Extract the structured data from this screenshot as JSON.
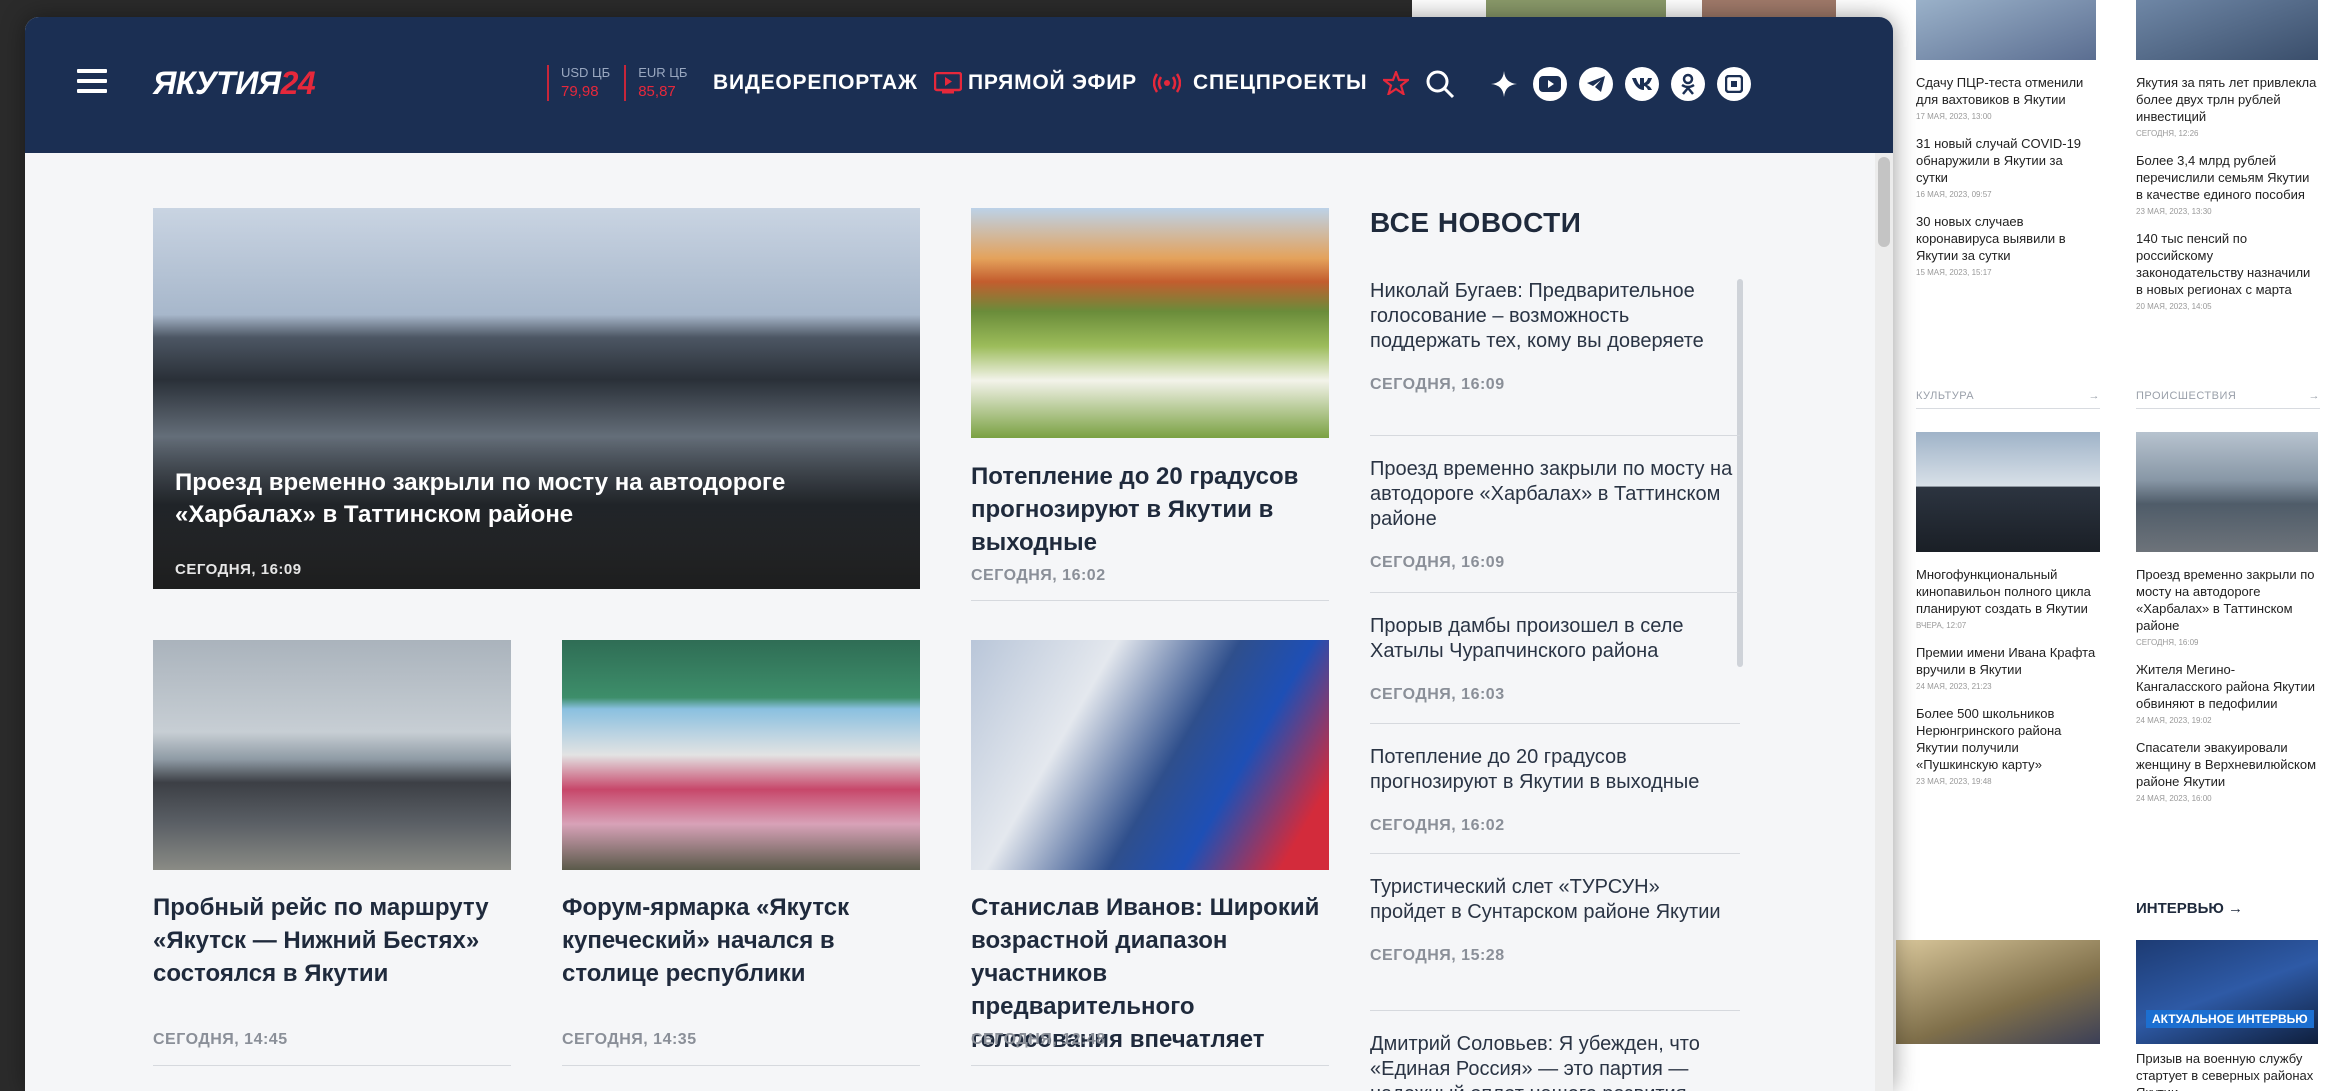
{
  "header": {
    "logo_main": "ЯКУТИЯ",
    "logo_accent": "24",
    "rates": [
      {
        "label": "USD ЦБ",
        "value": "79,98"
      },
      {
        "label": "EUR ЦБ",
        "value": "85,87"
      }
    ],
    "nav": [
      {
        "label": "ВИДЕОРЕПОРТАЖ",
        "icon": "video-icon"
      },
      {
        "label": "ПРЯМОЙ ЭФИР",
        "icon": "broadcast-icon"
      },
      {
        "label": "СПЕЦПРОЕКТЫ",
        "icon": "star-icon"
      }
    ],
    "socials": [
      "zen-icon",
      "youtube-icon",
      "telegram-icon",
      "vk-icon",
      "ok-icon",
      "rutube-icon"
    ]
  },
  "hero": {
    "title": "Проезд временно закрыли по мосту на автодороге «Харбалах» в Таттинском районе",
    "date": "СЕГОДНЯ, 16:09"
  },
  "cards": [
    {
      "title": "Потепление до  20 градусов прогнозируют в Якутии в выходные",
      "date": "СЕГОДНЯ, 16:02"
    },
    {
      "title": "Пробный рейс по маршруту «Якутск — Нижний Бестях» состоялся в Якутии",
      "date": "СЕГОДНЯ, 14:45"
    },
    {
      "title": "Форум-ярмарка «Якутск купеческий» начался в столице республики",
      "date": "СЕГОДНЯ, 14:35"
    },
    {
      "title": "Станислав Иванов: Широкий возрастной диапазон участников предварительного голосования впечатляет",
      "date": "СЕГОДНЯ, 12:48"
    }
  ],
  "all_news": {
    "heading": "ВСЕ НОВОСТИ",
    "items": [
      {
        "title": "Николай Бугаев: Предварительное голосование – возможность поддержать тех, кому вы доверяете",
        "date": "СЕГОДНЯ, 16:09"
      },
      {
        "title": "Проезд временно закрыли по мосту на автодороге «Харбалах» в Таттинском районе",
        "date": "СЕГОДНЯ, 16:09"
      },
      {
        "title": "Прорыв дамбы произошел в селе Хатылы Чурапчинского района",
        "date": "СЕГОДНЯ, 16:03"
      },
      {
        "title": "Потепление до  20 градусов прогнозируют в Якутии в выходные",
        "date": "СЕГОДНЯ, 16:02"
      },
      {
        "title": "Туристический слет «ТУРСУН» пройдет в Сунтарском районе Якутии",
        "date": "СЕГОДНЯ, 15:28"
      },
      {
        "title": "Дмитрий Соловьев: Я убежден, что «Единая Россия» — это партия — надежный оплот нашего развития",
        "date": ""
      }
    ]
  },
  "background_page": {
    "col1": [
      {
        "title": "Сдачу ПЦР-теста отменили для вахтовиков в Якутии",
        "date": "17 мая, 2023, 13:00"
      },
      {
        "title": "31 новый случай COVID-19 обнаружили в Якутии за сутки",
        "date": "16 мая, 2023, 09:57"
      },
      {
        "title": "30 новых случаев коронавируса выявили в Якутии за сутки",
        "date": "15 мая, 2023, 15:17"
      }
    ],
    "col2": [
      {
        "title": "Якутия за пять лет привлекла более двух трлн рублей инвестиций",
        "date": "Сегодня, 12:26"
      },
      {
        "title": "Более 3,4 млрд рублей перечислили семьям Якутии в качестве единого пособия",
        "date": "23 мая, 2023, 13:30"
      },
      {
        "title": "140 тыс пенсий по российскому законодательству назначили в новых регионах с марта",
        "date": "20 мая, 2023, 14:05"
      }
    ],
    "rubric1": "КУЛЬТУРА",
    "rubric2": "ПРОИСШЕСТВИЯ",
    "culture": [
      {
        "title": "Многофункциональный кинопавильон полного цикла планируют создать в Якутии",
        "date": "Вчера, 12:07"
      },
      {
        "title": "Премии имени Ивана Крафта вручили в Якутии",
        "date": "24 мая, 2023, 21:23"
      },
      {
        "title": "Более 500 школьников Нерюнгринского района Якутии получили «Пушкинскую карту»",
        "date": "23 мая, 2023, 19:48"
      }
    ],
    "incidents": [
      {
        "title": "Проезд временно закрыли по мосту на автодороге «Харбалах» в Таттинском районе",
        "date": "Сегодня, 16:09"
      },
      {
        "title": "Жителя Мегино-Кангаласского района Якутии обвиняют в педофилии",
        "date": "24 мая, 2023, 19:02"
      },
      {
        "title": "Спасатели эвакуировали женщину в Верхневилюйском районе Якутии",
        "date": "24 мая, 2023, 16:00"
      }
    ],
    "interview_heading": "ИНТЕРВЬЮ →",
    "interview_badge": "АКТУАЛЬНОЕ ИНТЕРВЬЮ",
    "interview_title": "Призыв на военную службу стартует в северных районах Якутии"
  }
}
